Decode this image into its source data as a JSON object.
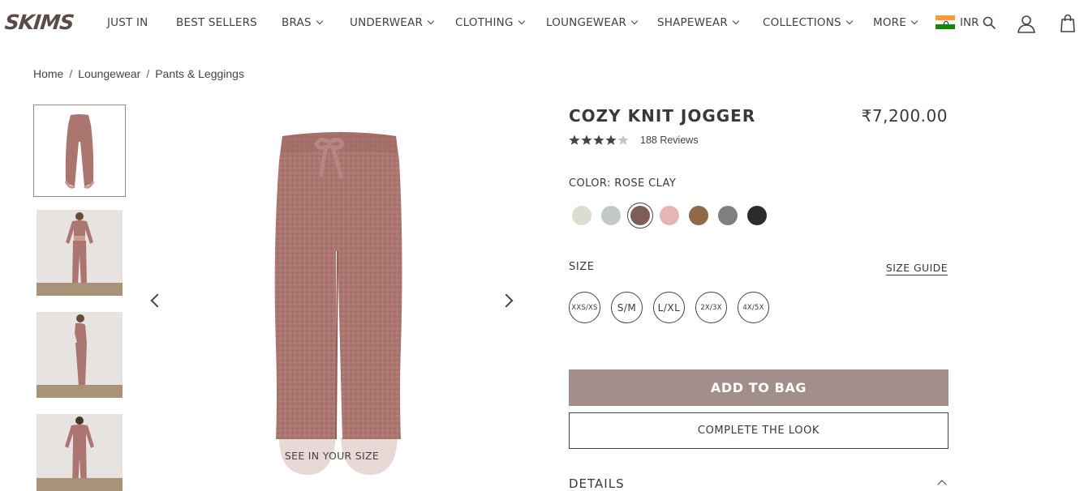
{
  "brand": {
    "logo_text": "SKIMS"
  },
  "nav": {
    "items": [
      {
        "label": "JUST IN",
        "has_dropdown": false
      },
      {
        "label": "BEST SELLERS",
        "has_dropdown": false
      },
      {
        "label": "BRAS",
        "has_dropdown": true
      },
      {
        "label": "UNDERWEAR",
        "has_dropdown": true
      },
      {
        "label": "CLOTHING",
        "has_dropdown": true
      },
      {
        "label": "LOUNGEWEAR",
        "has_dropdown": true
      },
      {
        "label": "SHAPEWEAR",
        "has_dropdown": true
      },
      {
        "label": "COLLECTIONS",
        "has_dropdown": true
      },
      {
        "label": "MORE",
        "has_dropdown": true
      }
    ],
    "currency": "INR",
    "icons": [
      "india-flag-icon",
      "search-icon",
      "account-icon",
      "shopping-bag-icon"
    ]
  },
  "breadcrumb": [
    "Home",
    "Loungewear",
    "Pants & Leggings"
  ],
  "gallery": {
    "thumbnails": [
      "product-flat-lay",
      "model-front",
      "model-side",
      "model-back"
    ],
    "active_index": 0,
    "see_in_your_size": "SEE IN YOUR SIZE"
  },
  "product": {
    "title": "COZY KNIT JOGGER",
    "price": "₹7,200.00",
    "rating": 4.5,
    "rating_max": 5,
    "reviews": "188 Reviews",
    "color_label": "COLOR: ROSE CLAY",
    "colors": [
      {
        "hex": "#dcdcd0",
        "selected": false
      },
      {
        "hex": "#c3c8c8",
        "selected": false
      },
      {
        "hex": "#7d5d5a",
        "selected": true
      },
      {
        "hex": "#e5b5b4",
        "selected": false
      },
      {
        "hex": "#8e6a47",
        "selected": false
      },
      {
        "hex": "#7f7f7f",
        "selected": false
      },
      {
        "hex": "#2b2c2e",
        "selected": false
      }
    ],
    "size_label": "SIZE",
    "size_guide": "SIZE GUIDE",
    "sizes": [
      "XXS/XS",
      "S/M",
      "L/XL",
      "2X/3X",
      "4X/5X"
    ],
    "add_to_bag": "ADD TO BAG",
    "complete_the_look": "COMPLETE THE LOOK",
    "details_label": "DETAILS"
  },
  "colors": {
    "text": "#3f3735",
    "fabric": "#ab7670",
    "add_to_bag_bg": "#a28f8c"
  }
}
